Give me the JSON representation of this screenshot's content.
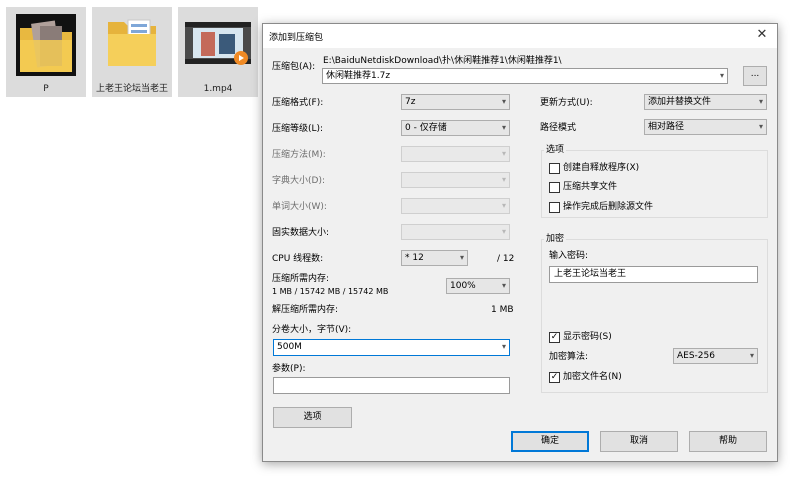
{
  "desktop": {
    "icons": [
      {
        "label": "P"
      },
      {
        "label": "上老王论坛当老王"
      },
      {
        "label": "1.mp4"
      }
    ]
  },
  "dialog": {
    "title": "添加到压缩包",
    "close_glyph": "✕",
    "archive": {
      "label": "压缩包(A):",
      "path": "E:\\BaiduNetdiskDownload\\扑\\休闲鞋推荐1\\休闲鞋推荐1\\",
      "filename": "休闲鞋推荐1.7z",
      "browse_label": "..."
    },
    "left": {
      "format": {
        "label": "压缩格式(F):",
        "value": "7z"
      },
      "level": {
        "label": "压缩等级(L):",
        "value": "0 - 仅存储"
      },
      "method": {
        "label": "压缩方法(M):",
        "value": ""
      },
      "dict": {
        "label": "字典大小(D):",
        "value": ""
      },
      "word": {
        "label": "单词大小(W):",
        "value": ""
      },
      "solid": {
        "label": "固实数据大小:",
        "value": ""
      },
      "cpu": {
        "label": "CPU 线程数:",
        "value": "* 12",
        "max": "/ 12"
      },
      "mem_compress": {
        "label": "压缩所需内存:",
        "detail": "1 MB / 15742 MB / 15742 MB",
        "value": "100%"
      },
      "mem_decompress": {
        "label": "解压缩所需内存:",
        "value": "1 MB"
      },
      "volume": {
        "label": "分卷大小，字节(V):",
        "value": "500M"
      },
      "params": {
        "label": "参数(P):",
        "value": ""
      },
      "options_button": "选项"
    },
    "right": {
      "update": {
        "label": "更新方式(U):",
        "value": "添加并替换文件"
      },
      "path_mode": {
        "label": "路径模式",
        "value": "相对路径"
      },
      "options_group": {
        "title": "选项",
        "sfx": {
          "label": "创建自释放程序(X)",
          "checked": false
        },
        "shared": {
          "label": "压缩共享文件",
          "checked": false
        },
        "delete": {
          "label": "操作完成后删除源文件",
          "checked": false
        }
      },
      "encryption": {
        "title": "加密",
        "password_label": "输入密码:",
        "password": "上老王论坛当老王",
        "show_password": {
          "label": "显示密码(S)",
          "checked": true
        },
        "method_label": "加密算法:",
        "method": "AES-256",
        "encrypt_names": {
          "label": "加密文件名(N)",
          "checked": true
        }
      }
    },
    "buttons": {
      "ok": "确定",
      "cancel": "取消",
      "help": "帮助"
    }
  }
}
